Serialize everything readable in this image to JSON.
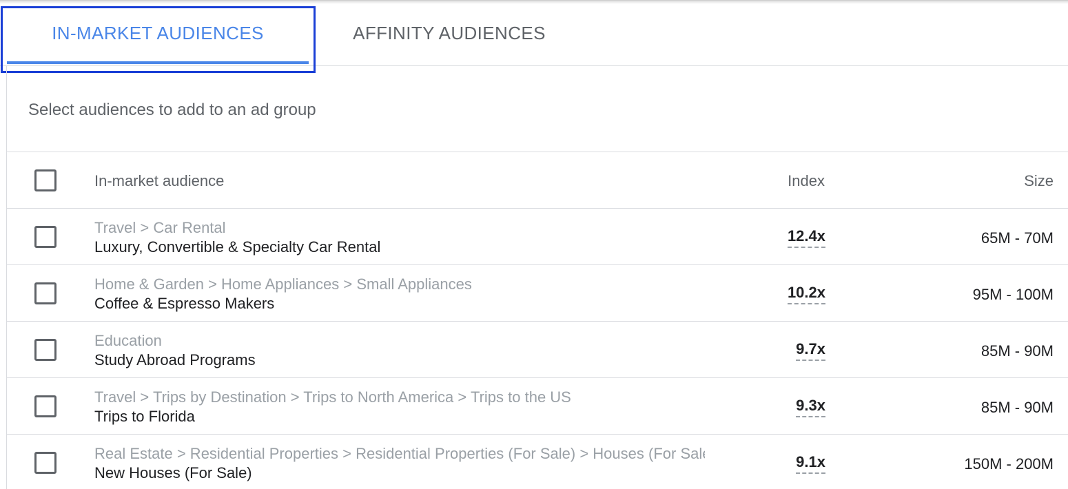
{
  "tabs": [
    {
      "label": "IN-MARKET AUDIENCES",
      "active": true
    },
    {
      "label": "AFFINITY AUDIENCES",
      "active": false
    }
  ],
  "instruction": "Select audiences to add to an ad group",
  "table": {
    "headers": {
      "audience": "In-market audience",
      "index": "Index",
      "size": "Size"
    },
    "rows": [
      {
        "path": "Travel > Car Rental",
        "name": "Luxury, Convertible & Specialty Car Rental",
        "index": "12.4x",
        "size": "65M - 70M"
      },
      {
        "path": "Home & Garden > Home Appliances > Small Appliances",
        "name": "Coffee & Espresso Makers",
        "index": "10.2x",
        "size": "95M - 100M"
      },
      {
        "path": "Education",
        "name": "Study Abroad Programs",
        "index": "9.7x",
        "size": "85M - 90M"
      },
      {
        "path": "Travel > Trips by Destination > Trips to North America > Trips to the US",
        "name": "Trips to Florida",
        "index": "9.3x",
        "size": "85M - 90M"
      },
      {
        "path": "Real Estate > Residential Properties > Residential Properties (For Sale) > Houses (For Sale)",
        "name": "New Houses (For Sale)",
        "index": "9.1x",
        "size": "150M - 200M"
      }
    ]
  },
  "colors": {
    "accent": "#4a86e8",
    "focus_outline": "#1a3fd6",
    "muted_text": "#9aa0a6",
    "secondary_text": "#5f6368",
    "primary_text": "#202124",
    "divider": "#dadce0"
  }
}
